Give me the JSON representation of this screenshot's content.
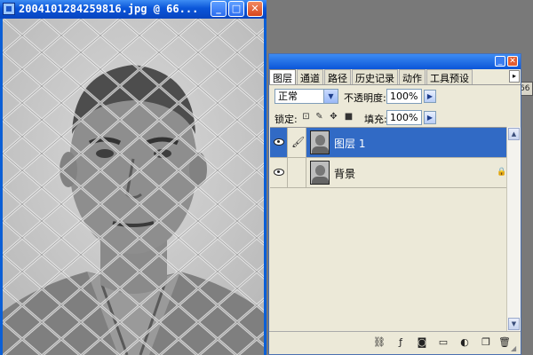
{
  "document_window": {
    "title": "2004101284259816.jpg @ 66...",
    "buttons": {
      "minimize": "_",
      "maximize": "□",
      "close": "✕"
    }
  },
  "side_tag": {
    "text": "66"
  },
  "layers_panel": {
    "tabs": [
      "图层",
      "通道",
      "路径",
      "历史记录",
      "动作",
      "工具预设"
    ],
    "active_tab": "图层",
    "tab_more_arrow": "▸",
    "blend_mode": "正常",
    "opacity_label": "不透明度:",
    "opacity_value": "100%",
    "lock_label": "锁定:",
    "lock_icons": [
      "lock-transparent-icon",
      "lock-brush-icon",
      "lock-move-icon",
      "lock-all-icon"
    ],
    "fill_label": "填充:",
    "fill_value": "100%",
    "layers": [
      {
        "name": "图层 1",
        "selected": true,
        "visible": true,
        "locked": false
      },
      {
        "name": "背景",
        "selected": false,
        "visible": true,
        "locked": true
      }
    ],
    "bottom_icons": [
      "link-layers-icon",
      "layer-style-icon",
      "layer-mask-icon",
      "new-group-icon",
      "adjustment-layer-icon",
      "new-layer-icon",
      "trash-icon"
    ]
  },
  "colors": {
    "xp_title_blue": "#0a55d8",
    "selected_row": "#316ac5",
    "panel_bg": "#ece9d8",
    "workspace_gray": "#797979"
  }
}
